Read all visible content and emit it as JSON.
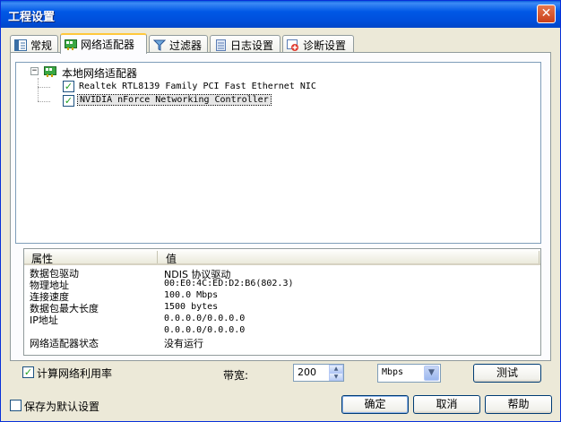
{
  "window": {
    "title": "工程设置"
  },
  "tabs": [
    {
      "label": "常规",
      "icon": "general-icon"
    },
    {
      "label": "网络适配器",
      "icon": "network-adapter-icon"
    },
    {
      "label": "过滤器",
      "icon": "filter-icon"
    },
    {
      "label": "日志设置",
      "icon": "log-icon"
    },
    {
      "label": "诊断设置",
      "icon": "diagnosis-icon"
    }
  ],
  "tree": {
    "root": "本地网络适配器",
    "items": [
      {
        "label": "Realtek RTL8139 Family PCI Fast Ethernet NIC",
        "checked": true
      },
      {
        "label": "NVIDIA nForce Networking Controller",
        "checked": true,
        "selected": true
      }
    ]
  },
  "properties": {
    "headers": {
      "name": "属性",
      "value": "值"
    },
    "rows": [
      {
        "name": "数据包驱动",
        "value": "NDIS 协议驱动"
      },
      {
        "name": "物理地址",
        "value": "00:E0:4C:ED:D2:B6(802.3)"
      },
      {
        "name": "连接速度",
        "value": "100.0 Mbps"
      },
      {
        "name": "数据包最大长度",
        "value": "1500 bytes"
      },
      {
        "name": "IP地址",
        "value": "0.0.0.0/0.0.0.0"
      },
      {
        "name": "",
        "value": "0.0.0.0/0.0.0.0"
      },
      {
        "name": "网络适配器状态",
        "value": "没有运行"
      }
    ]
  },
  "bandwidth": {
    "calc_label": "计算网络利用率",
    "calc_checked": true,
    "label": "带宽:",
    "value": "200",
    "unit": "Mbps",
    "test_label": "测试"
  },
  "footer": {
    "save_default_label": "保存为默认设置",
    "ok_label": "确定",
    "cancel_label": "取消",
    "help_label": "帮助"
  }
}
